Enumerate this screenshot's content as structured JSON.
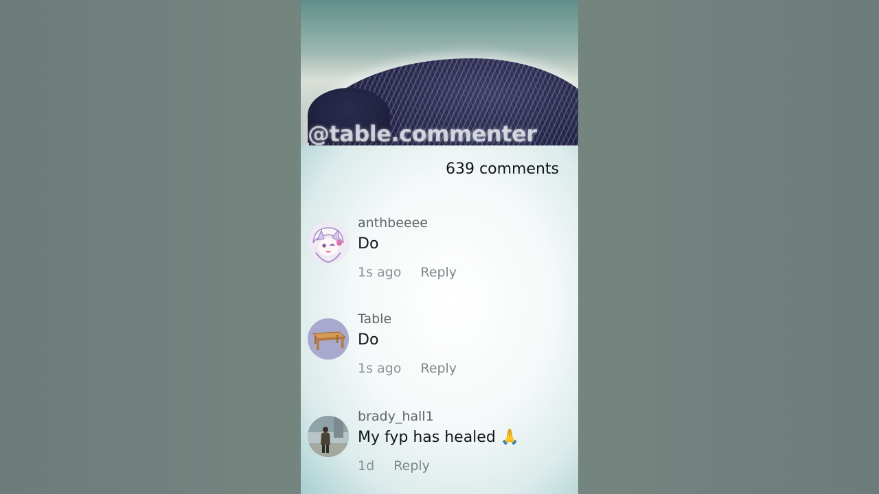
{
  "video": {
    "watermark": "@table.commenter"
  },
  "comments_panel": {
    "count_label": "639 comments",
    "comments": [
      {
        "username": "anthbeeee",
        "text": "Do",
        "time": "1s ago",
        "reply_label": "Reply",
        "avatar_icon": "anime-character-avatar-icon"
      },
      {
        "username": "Table",
        "text": "Do",
        "time": "1s ago",
        "reply_label": "Reply",
        "avatar_icon": "wooden-table-avatar-icon"
      },
      {
        "username": "brady_hall1",
        "text": "My fyp has healed 🙏",
        "time": "1d",
        "reply_label": "Reply",
        "avatar_icon": "person-walking-avatar-icon"
      }
    ]
  },
  "colors": {
    "background": "#6f807e",
    "text_primary": "#111417",
    "text_secondary": "#8a9094"
  }
}
